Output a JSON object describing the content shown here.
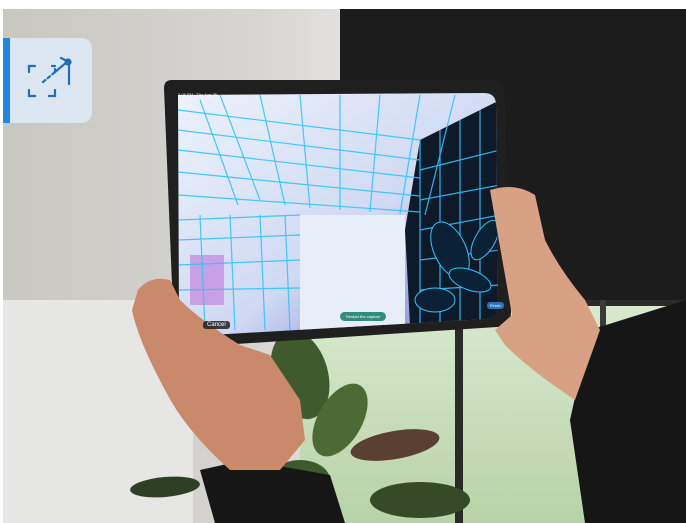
{
  "status_bar": {
    "time_date": "2:08 PM · Thu Aug 25"
  },
  "badge": {
    "icon": "room-scan-icon",
    "accent": "#1e88e5"
  },
  "scan_controls": {
    "cancel_label": "Cancel",
    "reset_label": "Restart the capture",
    "finish_label": "Finish"
  },
  "colors": {
    "mesh": "#2ec4ff",
    "badge_bg": "#dbe6f0"
  }
}
